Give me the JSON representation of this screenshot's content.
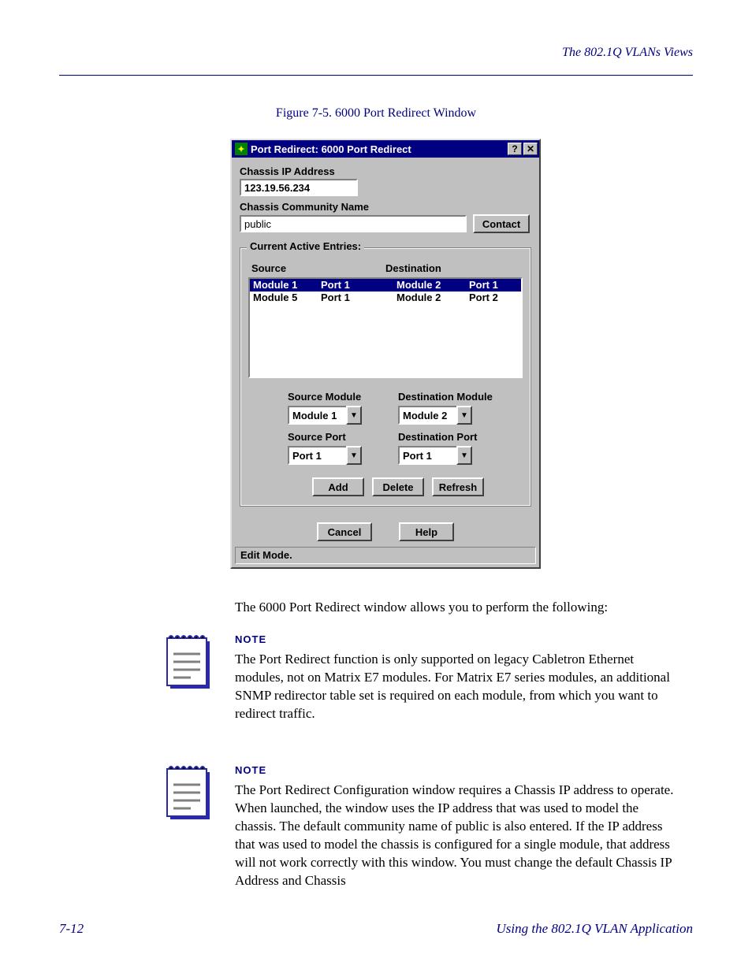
{
  "header": {
    "section": "The 802.1Q VLANs Views"
  },
  "figure": {
    "label": "Figure 7-5.",
    "title": "6000 Port Redirect Window"
  },
  "dialog": {
    "title": "Port Redirect: 6000 Port Redirect",
    "labels": {
      "ip": "Chassis IP Address",
      "community": "Chassis Community Name",
      "group": "Current Active Entries:",
      "source_col": "Source",
      "dest_col": "Destination",
      "src_module": "Source Module",
      "dst_module": "Destination Module",
      "src_port": "Source Port",
      "dst_port": "Destination Port"
    },
    "values": {
      "ip": "123.19.56.234",
      "community": "public",
      "src_module": "Module 1",
      "dst_module": "Module 2",
      "src_port": "Port 1",
      "dst_port": "Port 1"
    },
    "buttons": {
      "contact": "Contact",
      "add": "Add",
      "delete": "Delete",
      "refresh": "Refresh",
      "cancel": "Cancel",
      "help": "Help"
    },
    "rows": [
      {
        "sm": "Module 1",
        "sp": "Port 1",
        "dm": "Module 2",
        "dp": "Port 1",
        "selected": true
      },
      {
        "sm": "Module 5",
        "sp": "Port 1",
        "dm": "Module 2",
        "dp": "Port 2",
        "selected": false
      }
    ],
    "status": "Edit Mode."
  },
  "text": {
    "para1": "The 6000 Port Redirect window allows you to perform the following:",
    "note_label": "NOTE",
    "note1": "The Port Redirect function is only supported on legacy Cabletron Ethernet modules, not on Matrix E7 modules. For Matrix E7 series modules, an additional SNMP redirector table set is required on each module, from which you want to redirect traffic.",
    "note2": "The Port Redirect Configuration window requires a Chassis IP address to operate. When launched, the window uses the IP address that was used to model the chassis. The default community name of public is also entered. If the IP address that was used to model the chassis is configured for a single module, that address will not work correctly with this window. You must change the default Chassis IP Address and Chassis"
  },
  "footer": {
    "page": "7-12",
    "doc": "Using the 802.1Q VLAN Application"
  }
}
